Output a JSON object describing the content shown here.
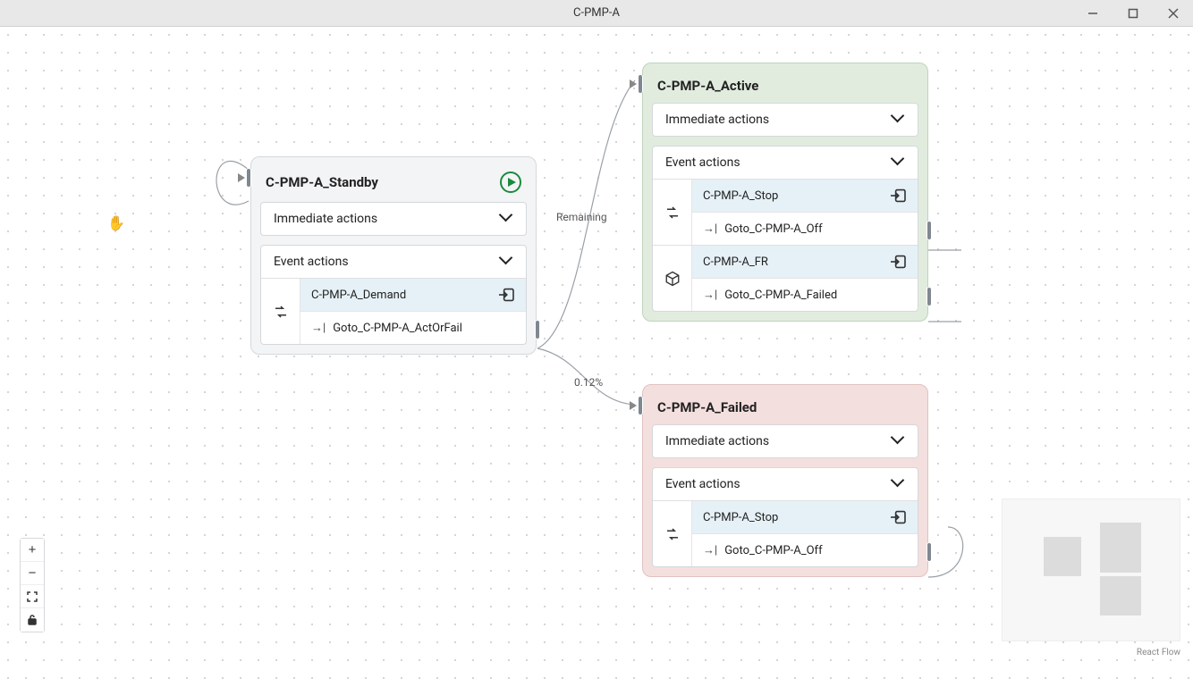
{
  "window": {
    "title": "C-PMP-A"
  },
  "edges": {
    "remaining_label": "Remaining",
    "fail_prob_label": "0.12%"
  },
  "nodes": {
    "standby": {
      "title": "C-PMP-A_Standby",
      "immediate_header": "Immediate actions",
      "event_header": "Event actions",
      "event1_name": "C-PMP-A_Demand",
      "event1_goto": "Goto_C-PMP-A_ActOrFail"
    },
    "active": {
      "title": "C-PMP-A_Active",
      "immediate_header": "Immediate actions",
      "event_header": "Event actions",
      "event1_name": "C-PMP-A_Stop",
      "event1_goto": "Goto_C-PMP-A_Off",
      "event2_name": "C-PMP-A_FR",
      "event2_goto": "Goto_C-PMP-A_Failed"
    },
    "failed": {
      "title": "C-PMP-A_Failed",
      "immediate_header": "Immediate actions",
      "event_header": "Event actions",
      "event1_name": "C-PMP-A_Stop",
      "event1_goto": "Goto_C-PMP-A_Off"
    }
  },
  "attribution": "React Flow"
}
